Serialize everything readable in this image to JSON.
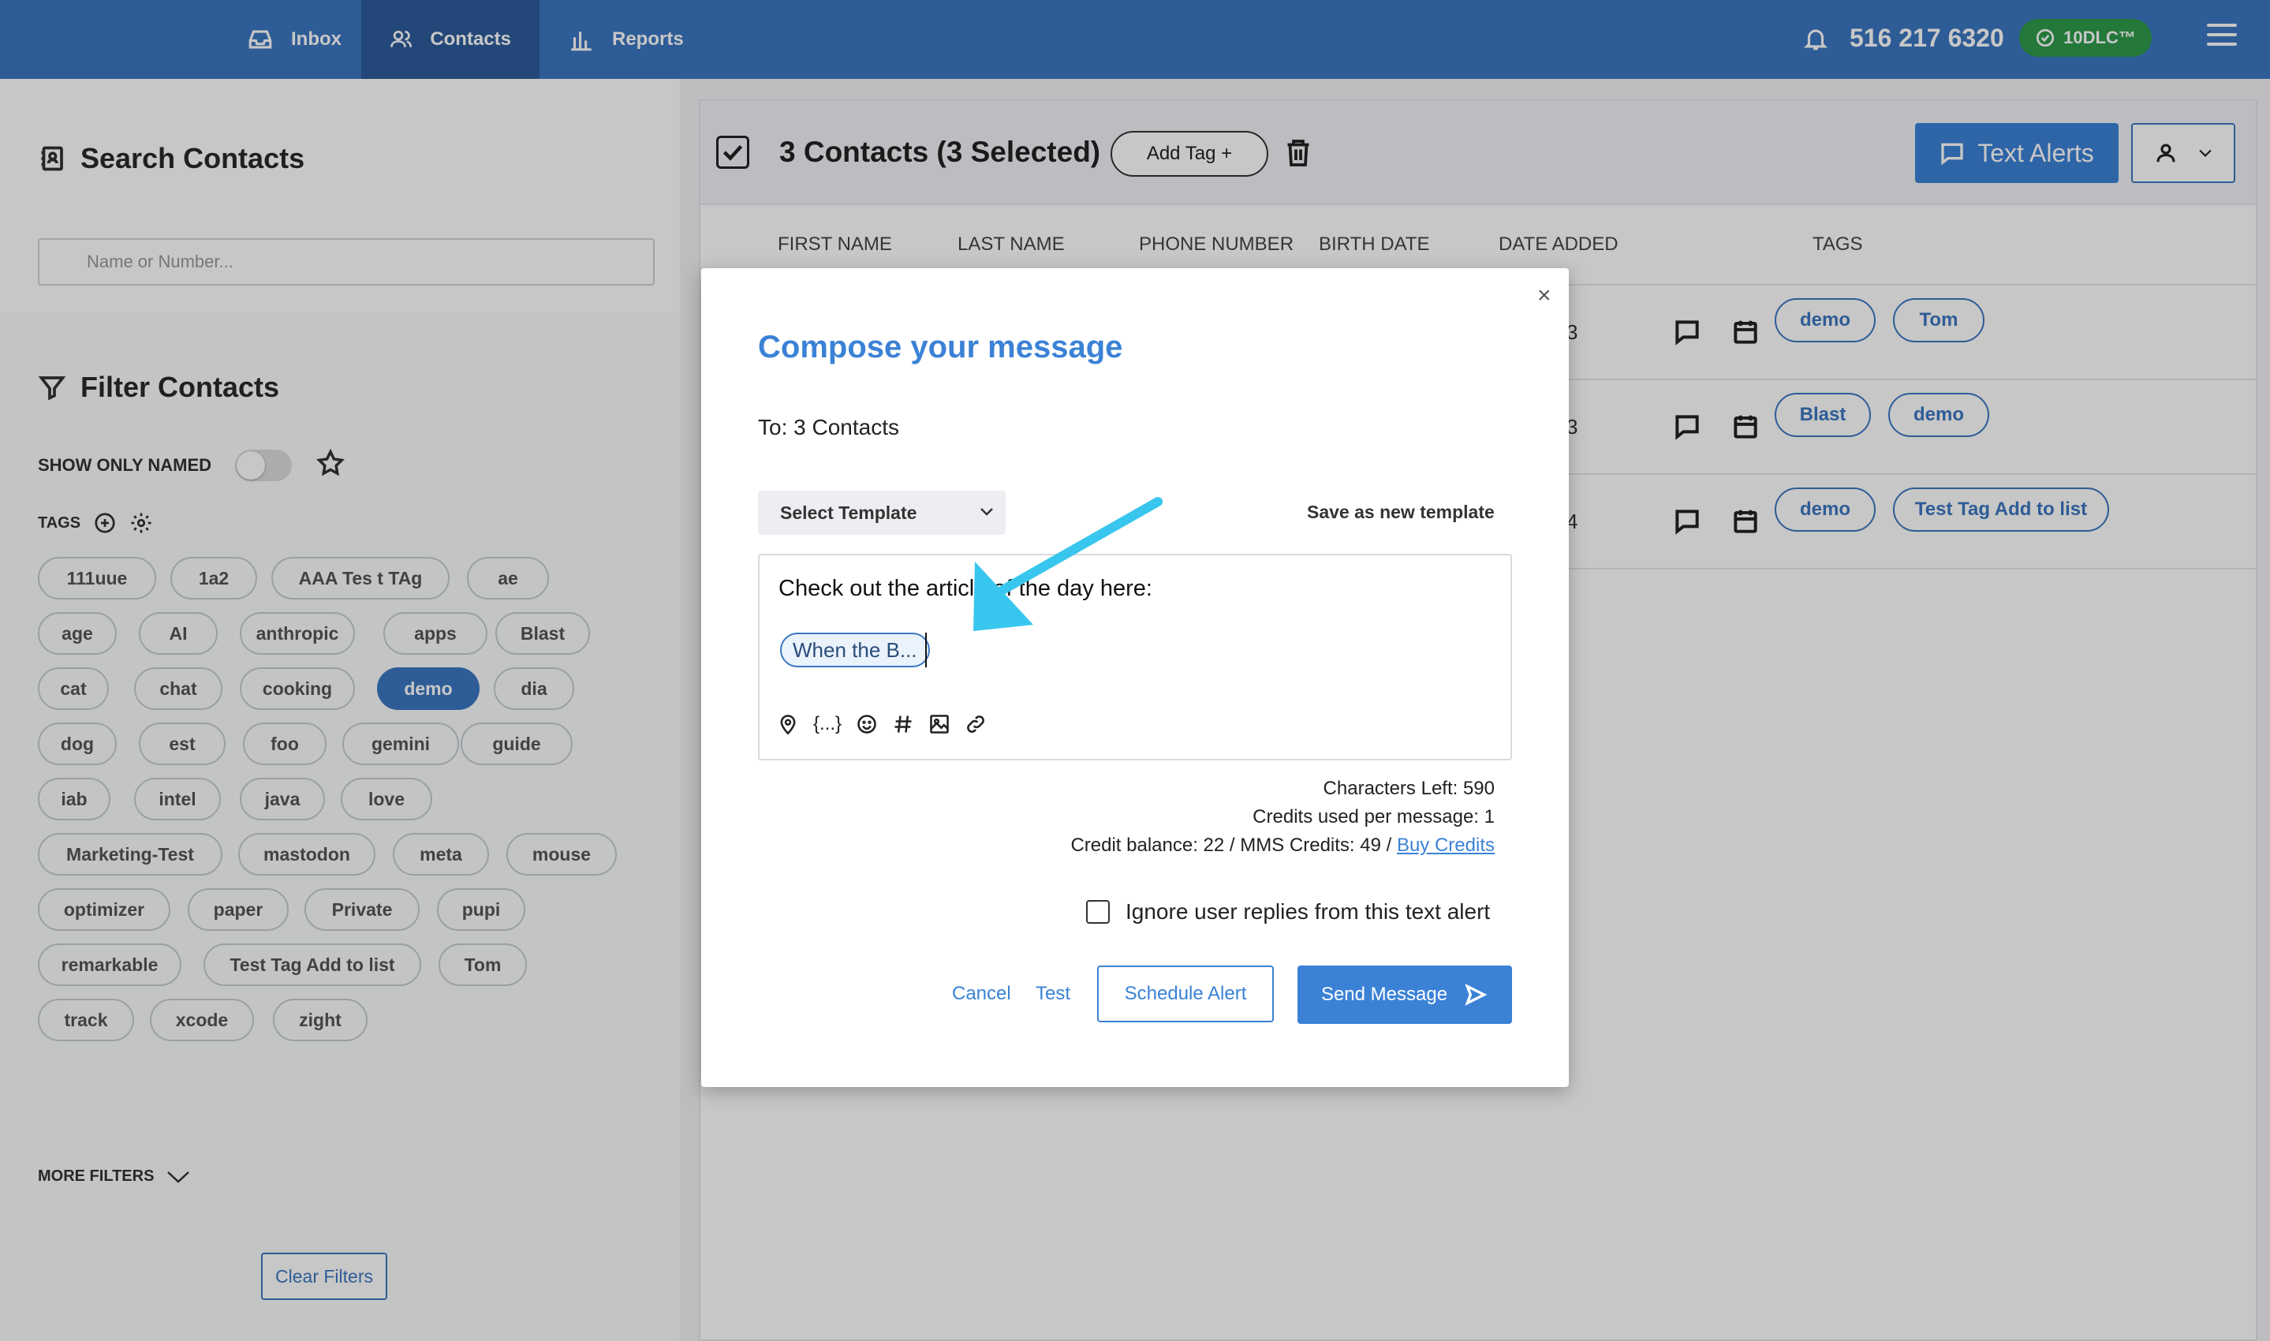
{
  "nav": {
    "tabs": [
      {
        "label": "Inbox",
        "icon": "inbox-icon"
      },
      {
        "label": "Contacts",
        "icon": "contacts-icon"
      },
      {
        "label": "Reports",
        "icon": "reports-icon"
      }
    ],
    "phone": "516 217 6320",
    "badge": "10DLC™"
  },
  "sidebar": {
    "search_title": "Search Contacts",
    "search_placeholder": "Name or Number...",
    "filter_title": "Filter Contacts",
    "show_only_named": "SHOW ONLY NAMED",
    "tags_label": "TAGS",
    "tags": [
      "111uue",
      "1a2",
      "AAA Tes t TAg",
      "ae",
      "age",
      "AI",
      "anthropic",
      "apps",
      "Blast",
      "cat",
      "chat",
      "cooking",
      "demo",
      "dia",
      "dog",
      "est",
      "foo",
      "gemini",
      "guide",
      "iab",
      "intel",
      "java",
      "love",
      "Marketing-Test",
      "mastodon",
      "meta",
      "mouse",
      "optimizer",
      "paper",
      "Private",
      "pupi",
      "remarkable",
      "Test Tag Add to list",
      "Tom",
      "track",
      "xcode",
      "zight"
    ],
    "active_tag": "demo",
    "more_filters": "MORE FILTERS",
    "clear_filters": "Clear Filters"
  },
  "main": {
    "title": "3 Contacts (3 Selected)",
    "add_tag": "Add Tag +",
    "text_alerts": "Text Alerts",
    "columns": [
      "FIRST NAME",
      "LAST NAME",
      "PHONE NUMBER",
      "BIRTH DATE",
      "DATE ADDED",
      "TAGS"
    ],
    "rows": [
      {
        "date_tail": "3",
        "tags": [
          "demo",
          "Tom"
        ]
      },
      {
        "date_tail": "3",
        "tags": [
          "Blast",
          "demo"
        ]
      },
      {
        "date_tail": "4",
        "tags": [
          "demo",
          "Test Tag Add to list"
        ]
      }
    ]
  },
  "modal": {
    "close": "×",
    "title": "Compose your message",
    "to": "To: 3 Contacts",
    "template_select": "Select Template",
    "save_template": "Save as new template",
    "message_text": "Check out the article of the day here:",
    "link_chip": "When the B...",
    "token": "{...}",
    "chars_left": "Characters Left: 590",
    "credits_per_message": "Credits used per message: 1",
    "credit_balance": "Credit balance: 22 / MMS Credits: 49 /",
    "buy_credits": "Buy Credits",
    "ignore_replies": "Ignore user replies from this text alert",
    "cancel": "Cancel",
    "test": "Test",
    "schedule": "Schedule Alert",
    "send": "Send Message"
  },
  "colors": {
    "nav_blue": "#3b76c0",
    "accent_blue": "#3b82d6",
    "badge_green": "#2d9a4b",
    "arrow_cyan": "#38c6ee"
  }
}
